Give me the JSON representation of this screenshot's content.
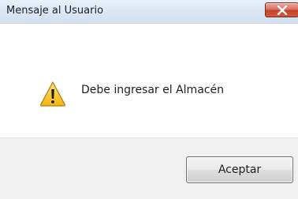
{
  "window": {
    "title": "Mensaje al Usuario"
  },
  "titlebar": {
    "close_icon": "close-icon"
  },
  "dialog": {
    "icon": "warning-icon",
    "message": "Debe ingresar el Almacén"
  },
  "buttons": {
    "accept_label": "Aceptar"
  },
  "colors": {
    "close_button": "#c6412a",
    "warning_fill": "#f6c21b"
  }
}
